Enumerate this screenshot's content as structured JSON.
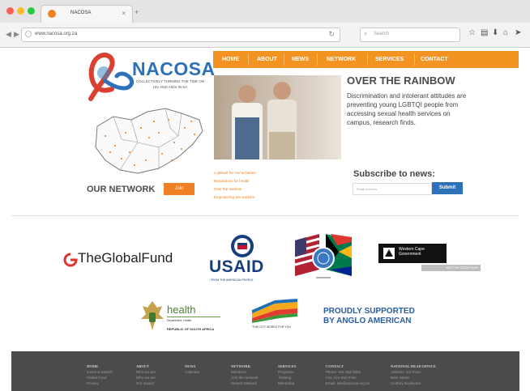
{
  "browser": {
    "tab_title": "NACOSA",
    "new_tab": "+",
    "tab_close": "×",
    "url": "www.nacosa.org.za",
    "reload": "↻",
    "search_placeholder": "Search"
  },
  "site": {
    "logo_title": "NACOSA",
    "logo_subtitle": "COLLECTIVELY TURNING THE TIDE ON HIV AND AIDS IN SA",
    "nav": [
      "HOME",
      "ABOUT",
      "NEWS",
      "NETWORK",
      "SERVICES",
      "CONTACT"
    ],
    "hero_title": "OVER THE RAINBOW",
    "hero_text": "Discrimination and intolerant attitudes are preventing young LGBTQI people from accessing sexual health services on campus, research finds.",
    "news_links": [
      "A default for HIV & babies",
      "Resolutions for health",
      "Over the rainbow",
      "Empowering sex workers"
    ],
    "our_network": "OUR NETWORK",
    "join": "Join",
    "subscribe_title": "Subscribe to news:",
    "email_placeholder": "Email address",
    "submit": "Submit"
  },
  "partners": {
    "global_fund": "TheGlobalFund",
    "usaid": "USAID",
    "usaid_sub": "FROM THE AMERICAN PEOPLE",
    "western_cape": "Western Cape Government",
    "better_together": "BETTER TOGETHER.",
    "health": "health",
    "health_sub": "Department: Health",
    "health_rsa": "REPUBLIC OF SOUTH AFRICA",
    "city": "THIS CITY WORKS FOR YOU",
    "anglo_line1": "PROUDLY SUPPORTED",
    "anglo_line2": "BY ANGLO AMERICAN"
  },
  "footer": {
    "columns": [
      {
        "head": "HOME",
        "items": [
          "Invest & Search",
          "Global Fund",
          "Privacy"
        ]
      },
      {
        "head": "ABOUT",
        "items": [
          "Who we are",
          "Who we are",
          "Our impact"
        ]
      },
      {
        "head": "NEWS",
        "items": [
          "Calendar"
        ]
      },
      {
        "head": "NETWORK",
        "items": [
          "Members",
          "Join the Network",
          "Search Network"
        ]
      },
      {
        "head": "SERVICES",
        "items": [
          "Programs",
          "Training",
          "Mentoring"
        ]
      },
      {
        "head": "CONTACT",
        "items": [
          "Phone: 021 552 0804",
          "Fax: 021 552 0762",
          "Email: info@nacosa.org.za"
        ]
      },
      {
        "head": "NATIONAL HEAD OFFICE",
        "items": [
          "Address: 3rd Floor,",
          "Bree Street",
          "Century Boulevard"
        ]
      }
    ]
  },
  "colors": {
    "accent_orange": "#f39322",
    "brand_blue": "#2d72b8",
    "footer_bg": "#4b4b4b"
  }
}
